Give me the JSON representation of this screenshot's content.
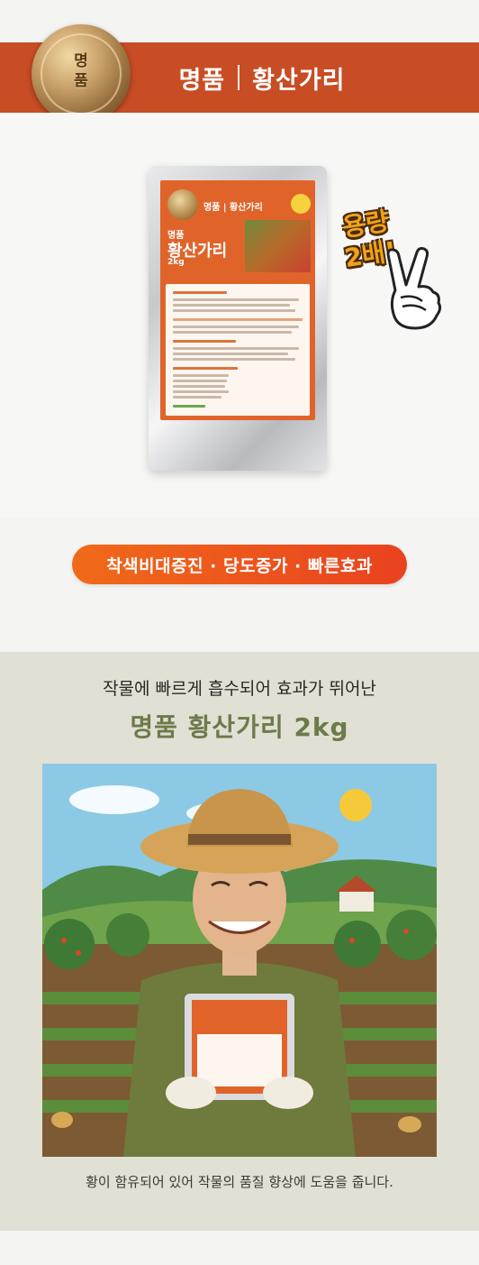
{
  "header": {
    "medal_text": [
      "명",
      "품"
    ],
    "title_left": "명품",
    "title_right": "황산가리"
  },
  "product": {
    "label_brand": "명품 | 황산가리",
    "label_sub": "명품",
    "label_name": "황산가리",
    "label_weight": "2kg",
    "badge_lines": [
      "용량",
      "2배!"
    ]
  },
  "features_pill": "착색비대증진 · 당도증가 · 빠른효과",
  "section": {
    "lead": "작물에 빠르게 흡수되어 효과가 뛰어난",
    "headline": "명품 황산가리 2kg",
    "caption": "황이 함유되어 있어 작물의 품질 향상에 도움을 줍니다."
  },
  "colors": {
    "banner": "#c84c24",
    "label_orange": "#e0642a",
    "pill_start": "#f06a1a",
    "pill_end": "#e9421f",
    "headline_green": "#6d7a4a",
    "lower_bg": "#e0e0d4"
  }
}
